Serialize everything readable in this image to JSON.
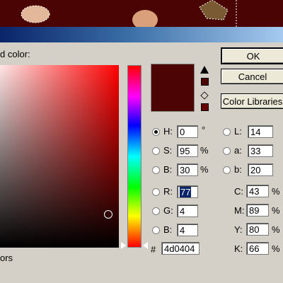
{
  "dialog": {
    "title_label": "d color:",
    "bottom_label": "ors"
  },
  "buttons": {
    "ok": "OK",
    "cancel": "Cancel",
    "color_libraries": "Color Libraries"
  },
  "swatch": {
    "new_color": "#4d0404",
    "gamut_color": "#4d0404",
    "web_color": "#660000"
  },
  "hsb": {
    "h": {
      "label": "H:",
      "value": "0",
      "unit": "°",
      "selected": true
    },
    "s": {
      "label": "S:",
      "value": "95",
      "unit": "%"
    },
    "b": {
      "label": "B:",
      "value": "30",
      "unit": "%"
    }
  },
  "rgb": {
    "r": {
      "label": "R:",
      "value": "77"
    },
    "g": {
      "label": "G:",
      "value": "4"
    },
    "b": {
      "label": "B:",
      "value": "4"
    }
  },
  "lab": {
    "l": {
      "label": "L:",
      "value": "14"
    },
    "a": {
      "label": "a:",
      "value": "33"
    },
    "b": {
      "label": "b:",
      "value": "20"
    }
  },
  "cmyk": {
    "c": {
      "label": "C:",
      "value": "43",
      "unit": "%"
    },
    "m": {
      "label": "M:",
      "value": "89",
      "unit": "%"
    },
    "y": {
      "label": "Y:",
      "value": "80",
      "unit": "%"
    },
    "k": {
      "label": "K:",
      "value": "66",
      "unit": "%"
    }
  },
  "hex": {
    "label": "#",
    "value": "4d0404"
  },
  "field": {
    "hue_color": "#ff0000"
  }
}
